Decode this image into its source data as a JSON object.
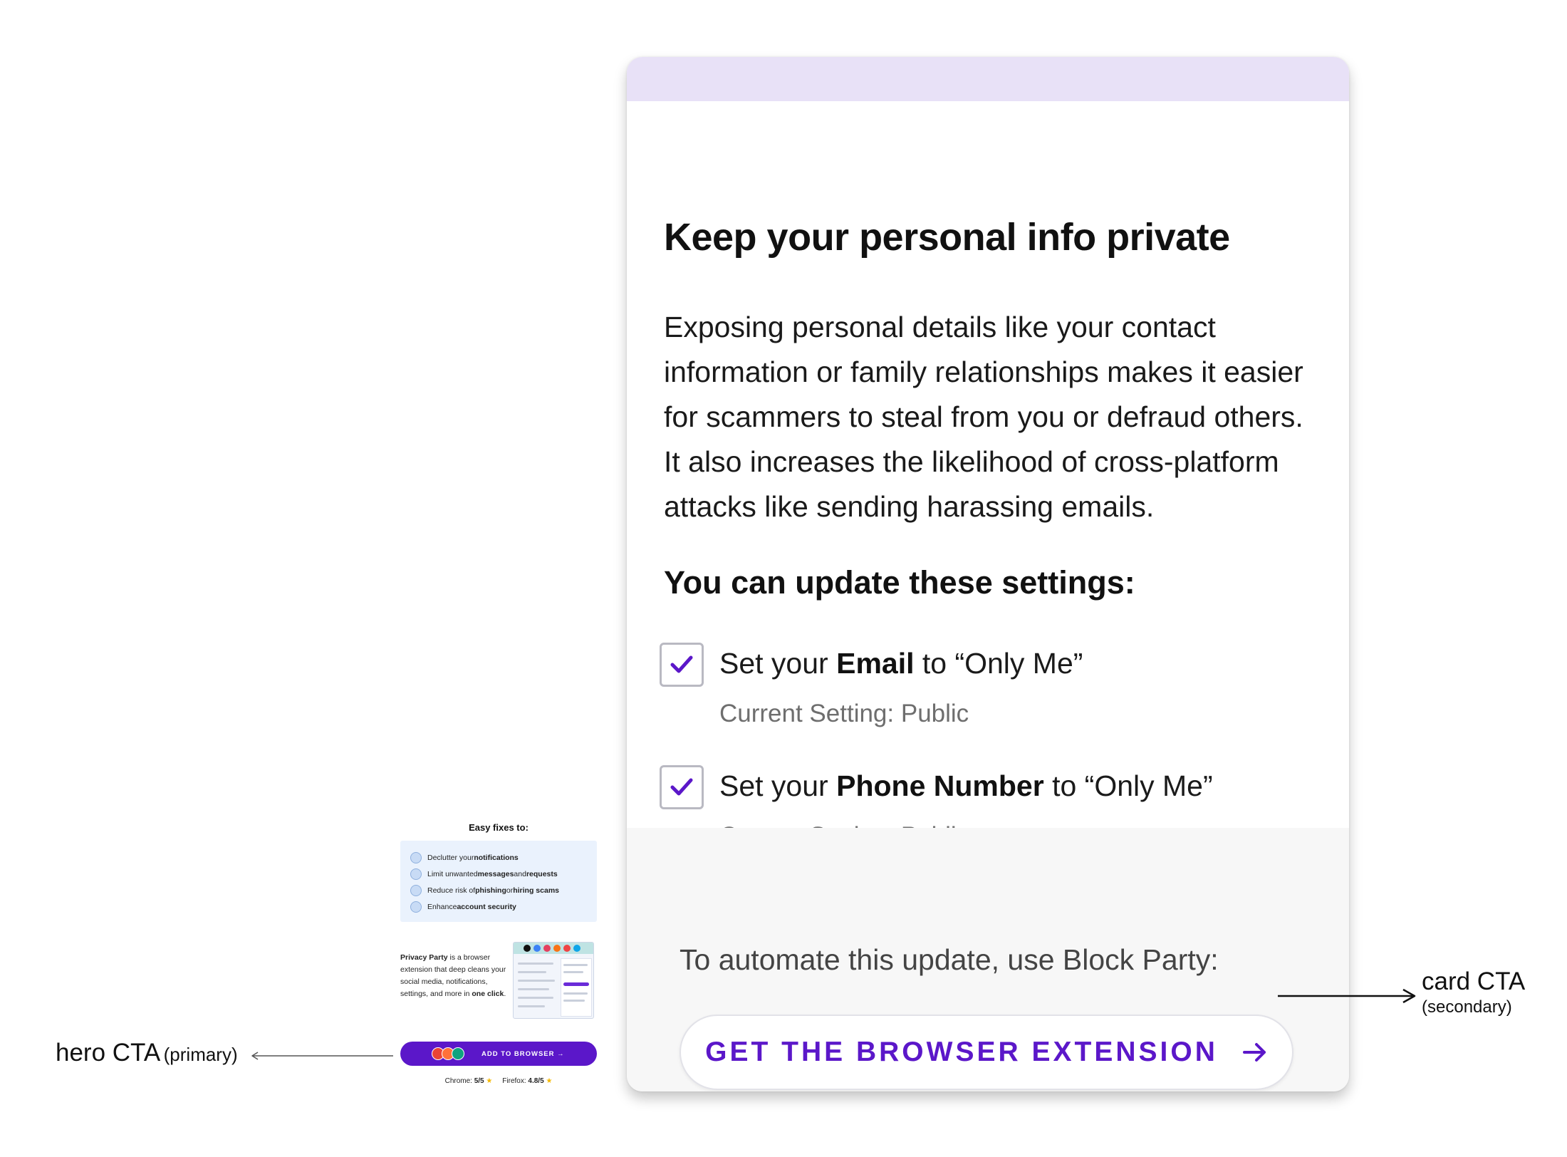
{
  "card": {
    "title": "Keep your personal info private",
    "body": "Exposing personal details like your contact information or family relationships makes it easier for scammers to steal from you or defraud others. It also increases the likelihood of cross-platform attacks like sending harassing emails.",
    "settings_heading": "You can update these settings:",
    "settings": [
      {
        "checked": true,
        "prefix": "Set your ",
        "field": "Email",
        "suffix": " to “Only Me”",
        "current": "Current Setting: Public"
      },
      {
        "checked": true,
        "prefix": "Set your ",
        "field": "Phone Number",
        "suffix": " to “Only Me”",
        "current": "Current Setting: Public"
      }
    ],
    "cta_intro": "To automate this update, use Block Party:",
    "cta_label": "GET THE BROWSER EXTENSION",
    "cta_icon": "arrow-right-icon"
  },
  "annotations": {
    "card_cta": {
      "main": "card CTA",
      "sub": "(secondary)"
    },
    "hero_cta": {
      "main": "hero CTA",
      "sub": "(primary)"
    }
  },
  "hero_thumbnail": {
    "title": "Easy fixes to:",
    "fixes": [
      {
        "prefix": "Declutter your ",
        "bold": "notifications",
        "mid": "",
        "bold2": "",
        "suffix": ""
      },
      {
        "prefix": "Limit unwanted ",
        "bold": "messages",
        "mid": " and ",
        "bold2": "requests",
        "suffix": ""
      },
      {
        "prefix": "Reduce risk of ",
        "bold": "phishing",
        "mid": " or ",
        "bold2": "hiring scams",
        "suffix": ""
      },
      {
        "prefix": "Enhance ",
        "bold": "account security",
        "mid": "",
        "bold2": "",
        "suffix": ""
      }
    ],
    "desc": {
      "bold1": "Privacy Party",
      "text1": " is a browser extension that deep cleans your social media, notifications, settings, and more in ",
      "bold2": "one click",
      "text2": "."
    },
    "cta_label": "ADD TO BROWSER →",
    "ratings": {
      "chrome_label": "Chrome: ",
      "chrome_value": "5/5",
      "firefox_label": "Firefox: ",
      "firefox_value": "4.8/5",
      "star": "★"
    }
  },
  "colors": {
    "accent": "#5b17c9",
    "band": "#e8e1f7",
    "cta_section_bg": "#f7f7f7",
    "fixes_bg": "#eaf2fd"
  }
}
